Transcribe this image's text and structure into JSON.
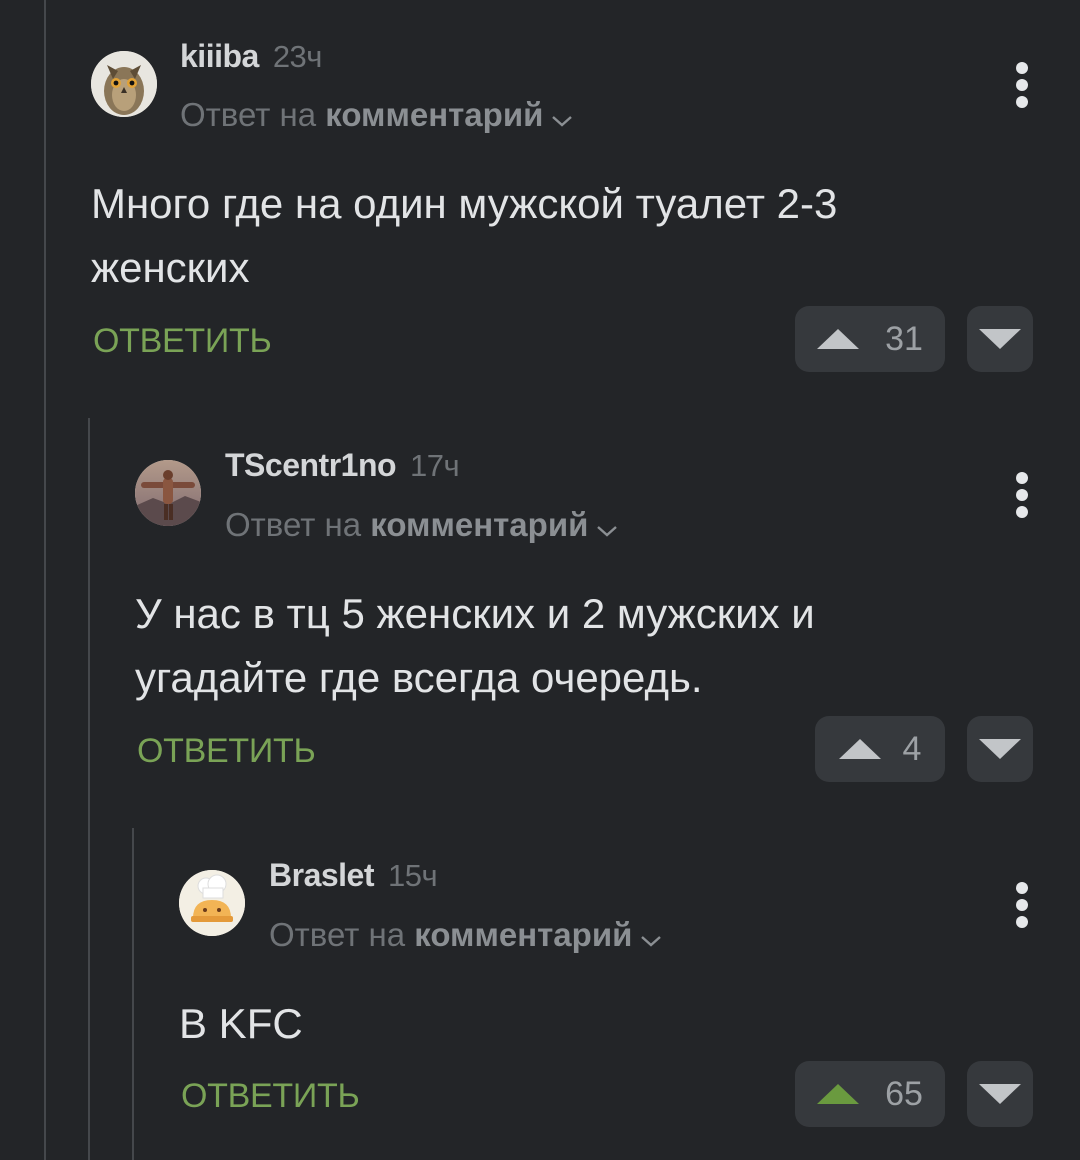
{
  "comments": [
    {
      "author": "kiiiba",
      "time": "23ч",
      "reply_prefix": "Ответ на",
      "reply_target": "комментарий",
      "text_lines": [
        "Много где на один мужской туалет 2-3",
        "женских"
      ],
      "reply_label": "ОТВЕТИТЬ",
      "rating": "31",
      "upvoted": false,
      "avatar_icon": "owl-avatar"
    },
    {
      "author": "TScentr1no",
      "time": "17ч",
      "reply_prefix": "Ответ на",
      "reply_target": "комментарий",
      "text_lines": [
        "У нас в тц 5 женских и 2 мужских и",
        "угадайте где всегда очередь."
      ],
      "reply_label": "ОТВЕТИТЬ",
      "rating": "4",
      "upvoted": false,
      "avatar_icon": "person-avatar"
    },
    {
      "author": "Braslet",
      "time": "15ч",
      "reply_prefix": "Ответ на",
      "reply_target": "комментарий",
      "text_lines": [
        "В KFC"
      ],
      "reply_label": "ОТВЕТИТЬ",
      "rating": "65",
      "upvoted": true,
      "avatar_icon": "chef-avatar"
    }
  ],
  "colors": {
    "background": "#232528",
    "reply_accent": "#7aa356",
    "upvoted": "#6a9a3f"
  }
}
